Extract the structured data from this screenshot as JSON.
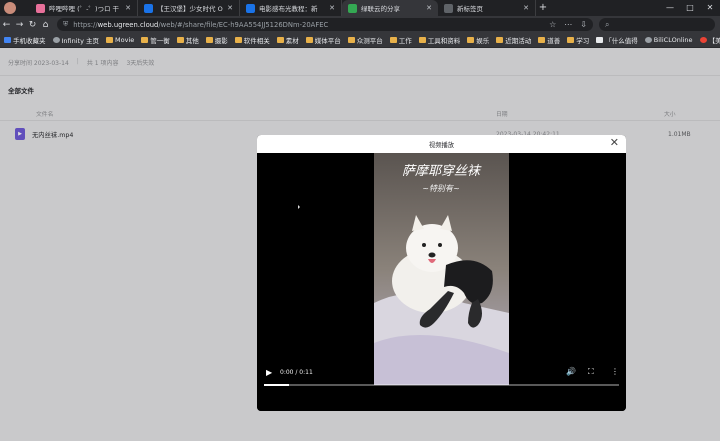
{
  "browser": {
    "tabs": [
      {
        "title": "哔哩哔哩 (゜-゜)つロ 干",
        "favicon": "bilibili-icon",
        "active": false
      },
      {
        "title": "【王汉堡】少女时代 Oh",
        "favicon": "video-site-icon",
        "active": false
      },
      {
        "title": "电影感布光教程：新",
        "favicon": "video-site-icon",
        "active": false
      },
      {
        "title": "绿联云的分享",
        "favicon": "ugreen-icon",
        "active": true
      },
      {
        "title": "新标签页",
        "favicon": "page-icon",
        "active": false
      }
    ],
    "new_tab_label": "+",
    "window_controls": [
      "—",
      "□",
      "✕"
    ],
    "url_prefix": "https://",
    "url_host": "web.ugreen.cloud",
    "url_path": "/web/#/share/file/EC-h9AA554JJ5126DNm-20AFEC",
    "search_icon": "search-icon"
  },
  "bookmarks": [
    {
      "label": "手机收藏夹",
      "icon": "bluebox"
    },
    {
      "label": "Infinity 主页",
      "icon": "circ"
    },
    {
      "label": "Movie",
      "icon": "folder"
    },
    {
      "label": "管一衡",
      "icon": "folder"
    },
    {
      "label": "其他",
      "icon": "folder"
    },
    {
      "label": "摄影",
      "icon": "folder"
    },
    {
      "label": "软件相关",
      "icon": "folder"
    },
    {
      "label": "素材",
      "icon": "folder"
    },
    {
      "label": "媒体平台",
      "icon": "folder"
    },
    {
      "label": "众测平台",
      "icon": "folder"
    },
    {
      "label": "工作",
      "icon": "folder"
    },
    {
      "label": "工具和资料",
      "icon": "folder"
    },
    {
      "label": "娱乐",
      "icon": "folder"
    },
    {
      "label": "近期活动",
      "icon": "folder"
    },
    {
      "label": "道善",
      "icon": "folder"
    },
    {
      "label": "学习",
      "icon": "folder"
    },
    {
      "label": "「什么值得",
      "icon": "whitebox"
    },
    {
      "label": "BiliCLOnline",
      "icon": "circ"
    },
    {
      "label": "【美",
      "icon": "redbox"
    }
  ],
  "share": {
    "meta_time": "分享时间 2023-03-14",
    "meta_count": "共 1 项内容",
    "meta_expire": "3天后失效",
    "section_title": "全部文件",
    "col_name": "文件名",
    "col_date": "日期",
    "col_size": "大小",
    "files": [
      {
        "name": "无内丝袜.mp4",
        "date": "2023-03-14 20:42:11",
        "size": "1.01MB",
        "icon": "video-file-icon"
      }
    ]
  },
  "modal": {
    "title": "视频播放",
    "close_label": "✕",
    "video": {
      "time": "0:00 / 0:11",
      "progress": 0.07,
      "frame_caption": "萨摩耶穿丝袜",
      "frame_subcaption": "~特别有~"
    }
  }
}
